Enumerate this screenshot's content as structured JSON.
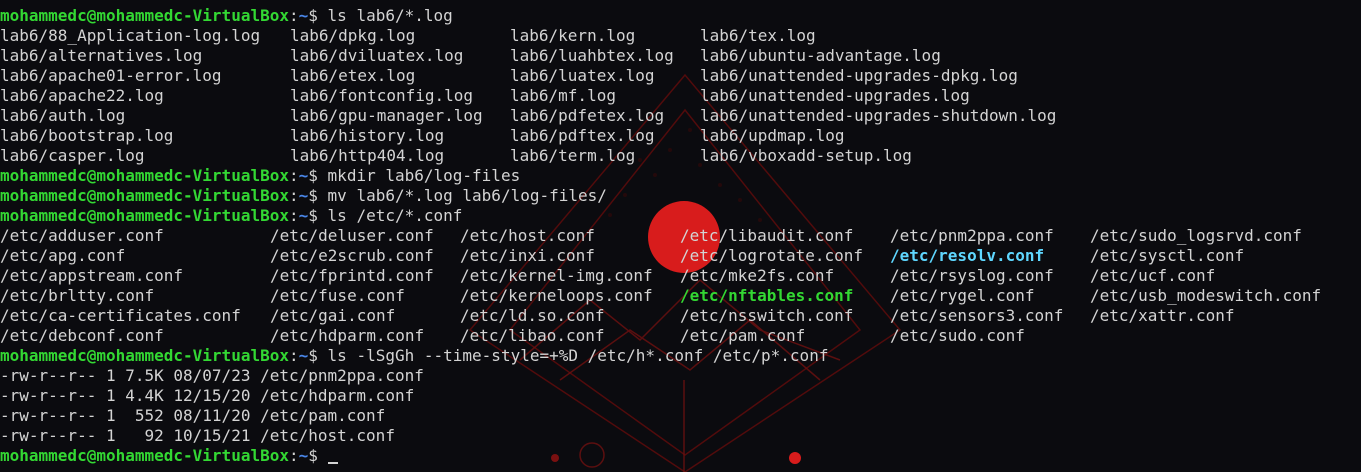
{
  "prompt": {
    "user_host": "mohammedc@mohammedc-VirtualBox",
    "path": "~",
    "symbol": "$"
  },
  "commands": {
    "cmd1": "ls lab6/*.log",
    "cmd2": "mkdir lab6/log-files",
    "cmd3": "mv lab6/*.log lab6/log-files/",
    "cmd4": "ls /etc/*.conf",
    "cmd5": "ls -lSgGh --time-style=+%D /etc/h*.conf /etc/p*.conf",
    "cmd6": ""
  },
  "log_listing": [
    [
      "lab6/88_Application-log.log",
      "lab6/dpkg.log",
      "lab6/kern.log",
      "lab6/tex.log"
    ],
    [
      "lab6/alternatives.log",
      "lab6/dviluatex.log",
      "lab6/luahbtex.log",
      "lab6/ubuntu-advantage.log"
    ],
    [
      "lab6/apache01-error.log",
      "lab6/etex.log",
      "lab6/luatex.log",
      "lab6/unattended-upgrades-dpkg.log"
    ],
    [
      "lab6/apache22.log",
      "lab6/fontconfig.log",
      "lab6/mf.log",
      "lab6/unattended-upgrades.log"
    ],
    [
      "lab6/auth.log",
      "lab6/gpu-manager.log",
      "lab6/pdfetex.log",
      "lab6/unattended-upgrades-shutdown.log"
    ],
    [
      "lab6/bootstrap.log",
      "lab6/history.log",
      "lab6/pdftex.log",
      "lab6/updmap.log"
    ],
    [
      "lab6/casper.log",
      "lab6/http404.log",
      "lab6/term.log",
      "lab6/vboxadd-setup.log"
    ]
  ],
  "conf_listing": [
    [
      "/etc/adduser.conf",
      "/etc/deluser.conf",
      "/etc/host.conf",
      "/etc/libaudit.conf",
      "/etc/pnm2ppa.conf",
      "/etc/sudo_logsrvd.conf"
    ],
    [
      "/etc/apg.conf",
      "/etc/e2scrub.conf",
      "/etc/inxi.conf",
      "/etc/logrotate.conf",
      "/etc/resolv.conf",
      "/etc/sysctl.conf"
    ],
    [
      "/etc/appstream.conf",
      "/etc/fprintd.conf",
      "/etc/kernel-img.conf",
      "/etc/mke2fs.conf",
      "/etc/rsyslog.conf",
      "/etc/ucf.conf"
    ],
    [
      "/etc/brltty.conf",
      "/etc/fuse.conf",
      "/etc/kerneloops.conf",
      "/etc/nftables.conf",
      "/etc/rygel.conf",
      "/etc/usb_modeswitch.conf"
    ],
    [
      "/etc/ca-certificates.conf",
      "/etc/gai.conf",
      "/etc/ld.so.conf",
      "/etc/nsswitch.conf",
      "/etc/sensors3.conf",
      "/etc/xattr.conf"
    ],
    [
      "/etc/debconf.conf",
      "/etc/hdparm.conf",
      "/etc/libao.conf",
      "/etc/pam.conf",
      "/etc/sudo.conf",
      ""
    ]
  ],
  "long_listing": [
    "-rw-r--r-- 1 7.5K 08/07/23 /etc/pnm2ppa.conf",
    "-rw-r--r-- 1 4.4K 12/15/20 /etc/hdparm.conf",
    "-rw-r--r-- 1  552 08/11/20 /etc/pam.conf",
    "-rw-r--r-- 1   92 10/15/21 /etc/host.conf"
  ],
  "colors": {
    "background": "#0b0b0f",
    "prompt_user": "#33d833",
    "prompt_path": "#4a86e8",
    "text": "#d4d4d4",
    "highlight_cyan": "#5fd7ff",
    "highlight_green": "#33d833",
    "wallpaper_accent": "#d81c1c"
  },
  "highlights": {
    "/etc/resolv.conf": "cyan",
    "/etc/nftables.conf": "green"
  }
}
